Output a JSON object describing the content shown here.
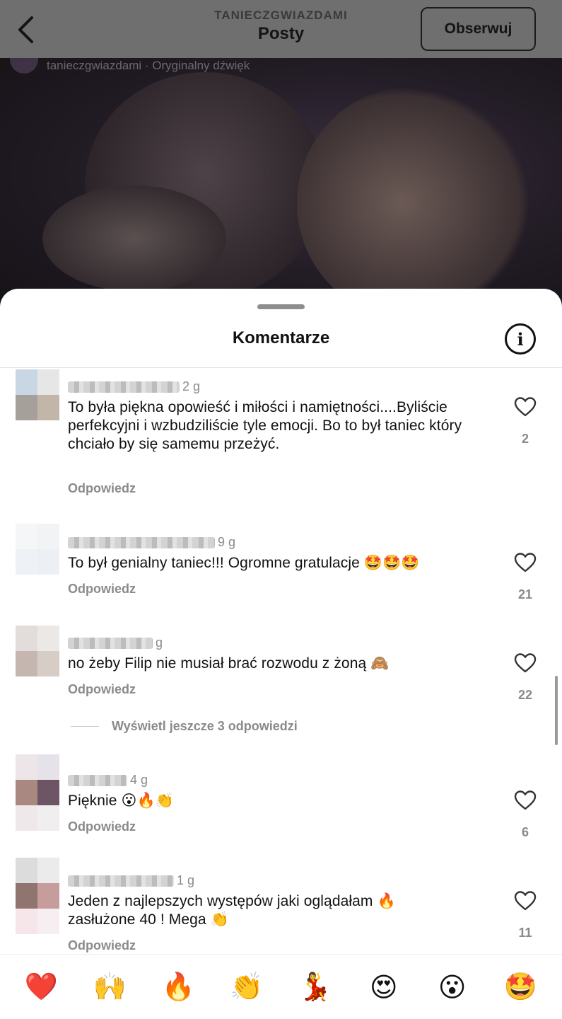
{
  "header": {
    "handle": "TANIECZGWIAZDAMI",
    "subtitle": "Posty",
    "follow_label": "Obserwuj"
  },
  "video": {
    "audio_text": "tanieczgwiazdami · Oryginalny dźwięk"
  },
  "sheet": {
    "title": "Komentarze",
    "info_glyph": "i"
  },
  "comments": [
    {
      "time": "2 g",
      "text": "To była piękna opowieść i miłości i namiętności....Byliście perfekcyjni i wzbudziliście tyle emocji. Bo to był taniec który chciało by się samemu przeżyć.",
      "reply_label": "Odpowiedz",
      "likes": "2"
    },
    {
      "time": "9 g",
      "text": "To był genialny taniec!!! Ogromne gratulacje 🤩🤩🤩",
      "reply_label": "Odpowiedz",
      "likes": "21"
    },
    {
      "time": "g",
      "text": "no żeby Filip nie musiał brać rozwodu z żoną 🙈",
      "reply_label": "Odpowiedz",
      "likes": "22"
    },
    {
      "time": "4 g",
      "text": "Pięknie 😮🔥👏",
      "reply_label": "Odpowiedz",
      "likes": "6"
    },
    {
      "time": "1 g",
      "text": "Jeden z najlepszych występów jaki oglądałam 🔥 zasłużone 40 ! Mega 👏",
      "reply_label": "Odpowiedz",
      "likes": "11"
    }
  ],
  "more_replies_label": "Wyświetl jeszcze 3 odpowiedzi",
  "reactions": [
    "❤️",
    "🙌",
    "🔥",
    "👏",
    "💃",
    "😍",
    "😮",
    "🤩"
  ],
  "colors": {
    "accent_text": "#111111",
    "muted_text": "#8a8a8a",
    "dim_overlay": "#6f6f70"
  }
}
